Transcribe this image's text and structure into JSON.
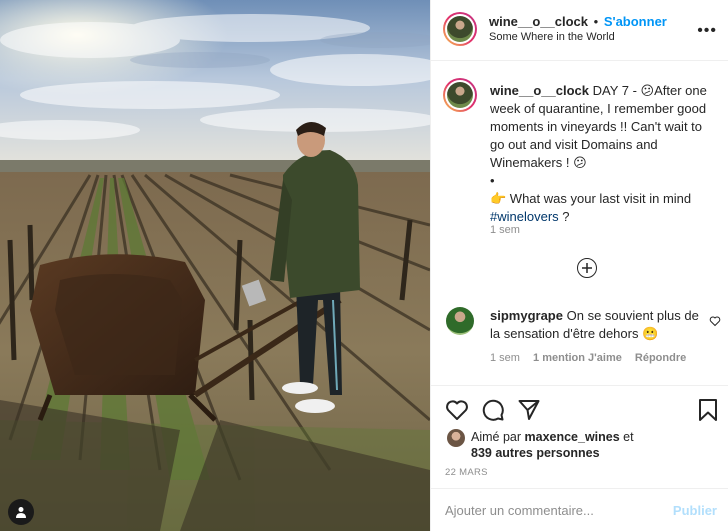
{
  "post": {
    "username": "wine__o__clock",
    "separator": "•",
    "follow_label": "S'abonner",
    "location": "Some Where in the World",
    "more_icon": "ellipsis-icon"
  },
  "caption": {
    "username": "wine__o__clock",
    "text_before_hashtag": "DAY 7 - 😕After one week of quarantine, I remember good moments in vineyards !! Can't wait to go out and visit Domains and Winemakers ! 😕\n•\n👉 What was your last visit in mind ",
    "hashtag": "#winelovers",
    "text_after_hashtag": " ?",
    "time": "1 sem"
  },
  "load_more_icon": "plus-circle-icon",
  "comment": {
    "username": "sipmygrape",
    "text": "On se souvient plus de la sensation d'être dehors 😬",
    "time": "1 sem",
    "likes": "1 mention J'aime",
    "reply_label": "Répondre"
  },
  "likes": {
    "prefix": "Aimé par ",
    "user": "maxence_wines",
    "middle": " et",
    "others": "839 autres personnes"
  },
  "date": "22 MARS",
  "add_comment": {
    "placeholder": "Ajouter un commentaire...",
    "publish_label": "Publier"
  },
  "colors": {
    "accent": "#0095f6",
    "publish_disabled": "#b2dffc",
    "hashtag": "#00376b",
    "muted": "#8e8e8e"
  }
}
